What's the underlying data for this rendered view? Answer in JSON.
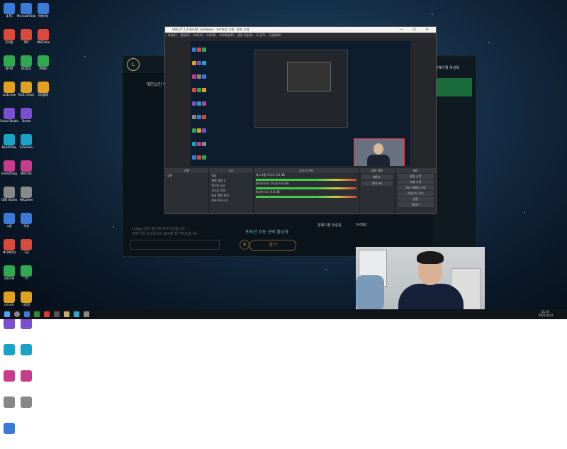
{
  "desktop": {
    "icons_col1": [
      "내 PC",
      "휴지통",
      "제어판",
      "Ludo.exe",
      "Visual Studio",
      "BandiView",
      "Everything",
      "OBS Studio",
      "크롬",
      "애니메이션",
      "카카오톡",
      "디스코드",
      "반디캠",
      "vs코드",
      "NetEase Music",
      "HuyaPC",
      "EVviewer"
    ],
    "icons_col2": [
      "Microsoft Edge",
      "QQ",
      "QQ音乐",
      "Rust Check",
      "Steam",
      "EvScreen",
      "WeChat",
      "Netgame",
      "엑셀",
      "구글",
      "YY",
      "다음팟",
      "애니",
      "QQPlayer",
      "KMPlayer",
      "게임"
    ],
    "icons_col3": [
      "이페이지",
      "WeGame",
      "PUBG",
      "QQ游戏"
    ]
  },
  "lol": {
    "title": "개인/2인 랭크",
    "auto_select": "포지션 자동 선택 활성화",
    "team_member1": "전혜기경 유성욱",
    "team_member2": "zxdlg1",
    "chat_hint": "zxdlg1님이 로비에 참가하셨습니다.",
    "chat_hint2": "전혜기경 유성욱님이 로비에 참가하셨습니다.",
    "find_match": "찾기",
    "right_name": "전혜기경 유성욱"
  },
  "obs": {
    "title": "OBS 27.1.3 (64-bit, windows) - 프로파일: 무제 - 장면: 무제",
    "window_controls": "— ☐ ✕",
    "menu": [
      "파일(F)",
      "편집(E)",
      "보기(V)",
      "도킹(D)",
      "프로파일(P)",
      "장면 모음(S)",
      "도구(T)",
      "도움말(H)"
    ],
    "dock_tabs": [
      "장면 전환",
      "장면",
      "필터"
    ],
    "scenes_header": "장면",
    "scenes": [
      "장면"
    ],
    "sources_header": "소스",
    "sources": [
      "영상",
      "화면 캡처 2",
      "미디어 소스",
      "오디오 입력",
      "영상 캡처 장치",
      "브라우저 소스"
    ],
    "mixer_header": "오디오 믹서",
    "mixer": [
      {
        "name": "데스크톱 오디오",
        "db": "0.0 dB"
      },
      {
        "name": "마이크/보조 오디오",
        "db": "0.0 dB"
      },
      {
        "name": "미디어 소스",
        "db": "0.0 dB"
      }
    ],
    "transition_header": "장면 전환",
    "transition_type": "페이드",
    "transition_duration": "300 ms",
    "controls_header": "제어",
    "controls": [
      "방송 시작",
      "녹화 시작",
      "가상 카메라 시작",
      "스튜디오 모드",
      "설정",
      "끝내기"
    ]
  },
  "taskbar": {
    "time": "11:47",
    "date": "2021/12/3"
  }
}
